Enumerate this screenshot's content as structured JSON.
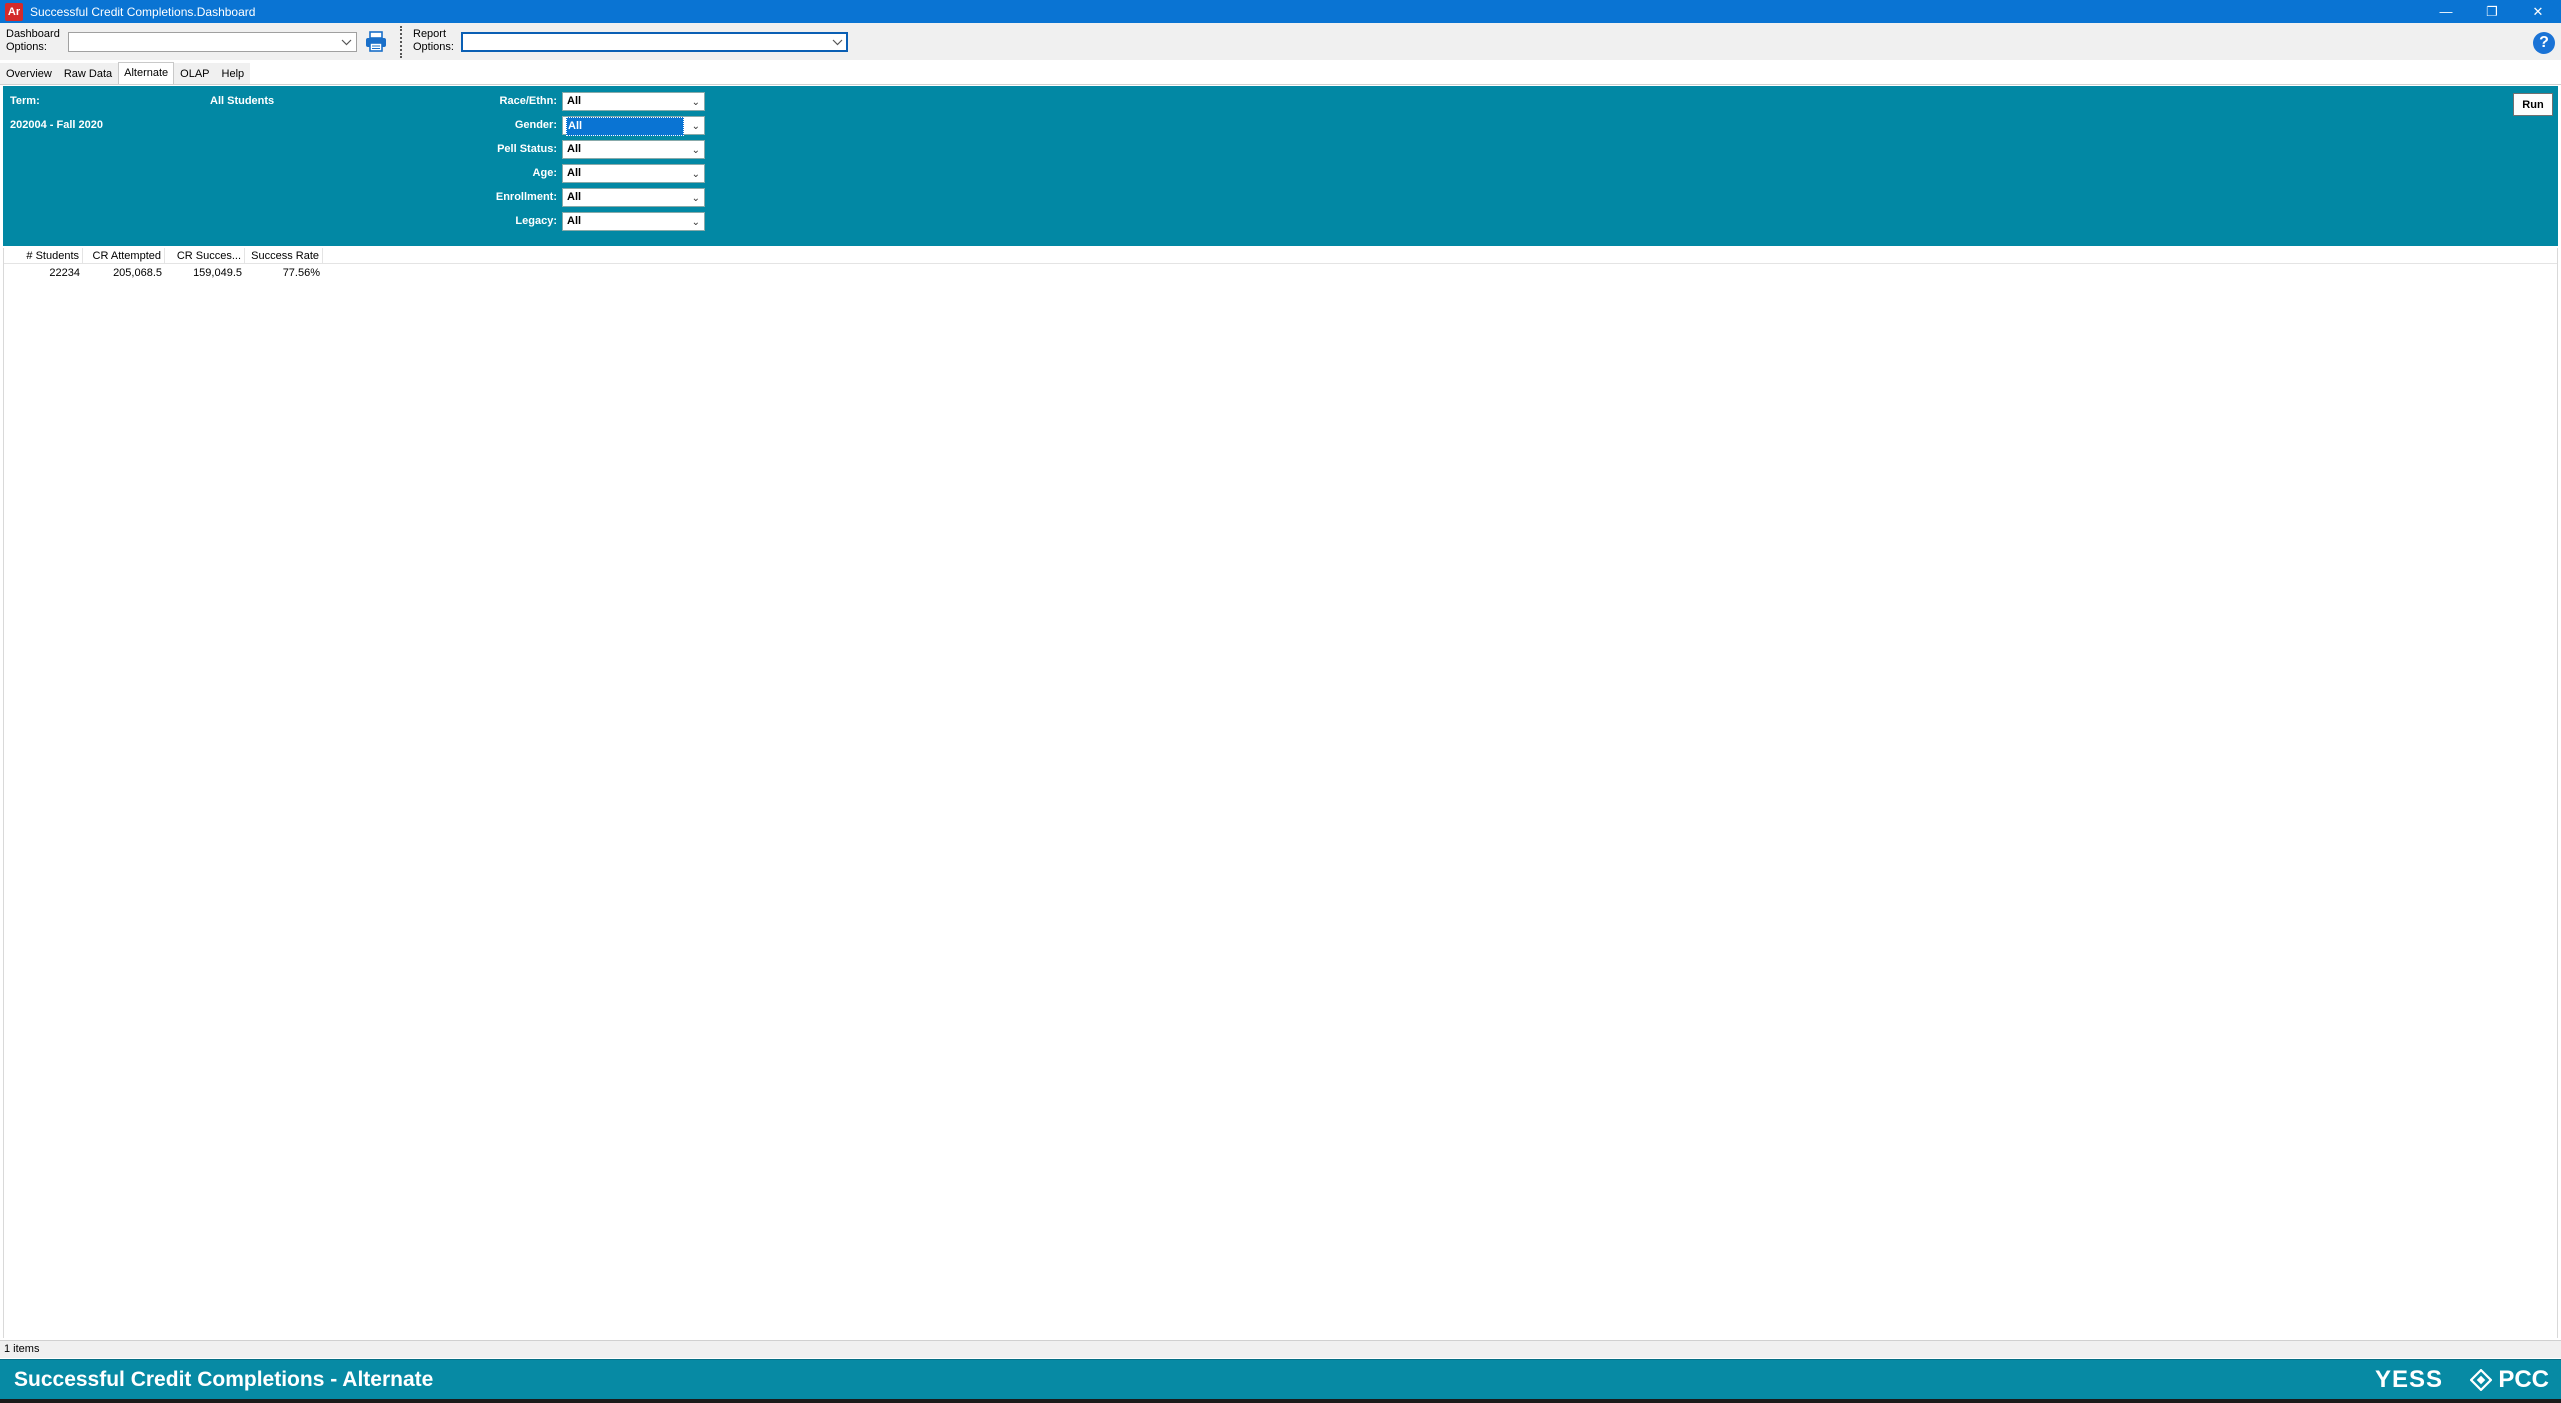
{
  "window": {
    "app_icon_text": "Ar",
    "title": "Successful Credit Completions.Dashboard",
    "minimize": "—",
    "restore": "❐",
    "close": "✕"
  },
  "toolbar": {
    "dashboard_options_label_1": "Dashboard",
    "dashboard_options_label_2": "Options:",
    "dashboard_options_value": "",
    "report_options_label_1": "Report",
    "report_options_label_2": "Options:",
    "report_options_value": "",
    "help_symbol": "?"
  },
  "tabs": [
    {
      "label": "Overview",
      "active": false
    },
    {
      "label": "Raw Data",
      "active": false
    },
    {
      "label": "Alternate",
      "active": true
    },
    {
      "label": "OLAP",
      "active": false
    },
    {
      "label": "Help",
      "active": false
    }
  ],
  "filters": {
    "term_label": "Term:",
    "term_value": "202004 - Fall 2020",
    "population": "All Students",
    "fields": [
      {
        "label": "Race/Ethn:",
        "value": "All"
      },
      {
        "label": "Gender:",
        "value": "All"
      },
      {
        "label": "Pell Status:",
        "value": "All"
      },
      {
        "label": "Age:",
        "value": "All"
      },
      {
        "label": "Enrollment:",
        "value": "All"
      },
      {
        "label": "Legacy:",
        "value": "All"
      }
    ],
    "run_label": "Run"
  },
  "grid": {
    "columns": [
      "# Students",
      "CR Attempted",
      "CR Succes...",
      "Success Rate"
    ],
    "rows": [
      [
        "22234",
        "205,068.5",
        "159,049.5",
        "77.56%"
      ]
    ]
  },
  "status": {
    "items_text": "1 items"
  },
  "footer": {
    "title": "Successful Credit Completions - Alternate",
    "logo_yess": "YESS",
    "logo_pcc": "PCC"
  },
  "colors": {
    "titlebar": "#0a74d3",
    "panel": "#0288a4",
    "footer": "#078aa4"
  }
}
